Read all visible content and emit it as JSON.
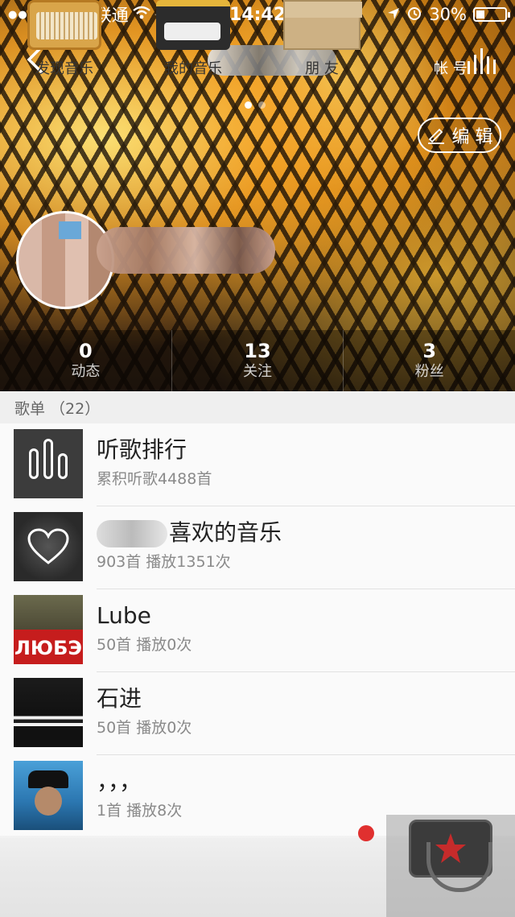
{
  "status_bar": {
    "carrier": "中国联通",
    "time": "14:42",
    "battery": "30%",
    "battery_level": 0.3
  },
  "header": {
    "edit_label": "编 辑"
  },
  "stats": [
    {
      "value": "0",
      "label": "动态"
    },
    {
      "value": "13",
      "label": "关注"
    },
    {
      "value": "3",
      "label": "粉丝"
    }
  ],
  "playlists": {
    "header": "歌单 （22）",
    "items": [
      {
        "title": "听歌排行",
        "subtitle": "累积听歌4488首",
        "icon": "bar-chart-icon"
      },
      {
        "title": "喜欢的音乐",
        "subtitle": "903首 播放1351次",
        "icon": "heart-icon"
      },
      {
        "title": "Lube",
        "subtitle": "50首 播放0次",
        "cover_text": "ЛЮБЭ"
      },
      {
        "title": "石进",
        "subtitle": "50首 播放0次"
      },
      {
        "title": "，，，",
        "subtitle": "1首 播放8次"
      }
    ]
  },
  "tabbar": {
    "tabs": [
      {
        "label": "发现音乐",
        "icon": "radio-icon"
      },
      {
        "label": "我的音乐",
        "icon": "cassette-icon"
      },
      {
        "label": "朋 友",
        "icon": "envelope-icon"
      },
      {
        "label": "帐 号",
        "icon": "bag-icon",
        "active": true
      }
    ]
  },
  "colors": {
    "accent_red": "#e0302f",
    "list_bg": "#fafafa"
  }
}
